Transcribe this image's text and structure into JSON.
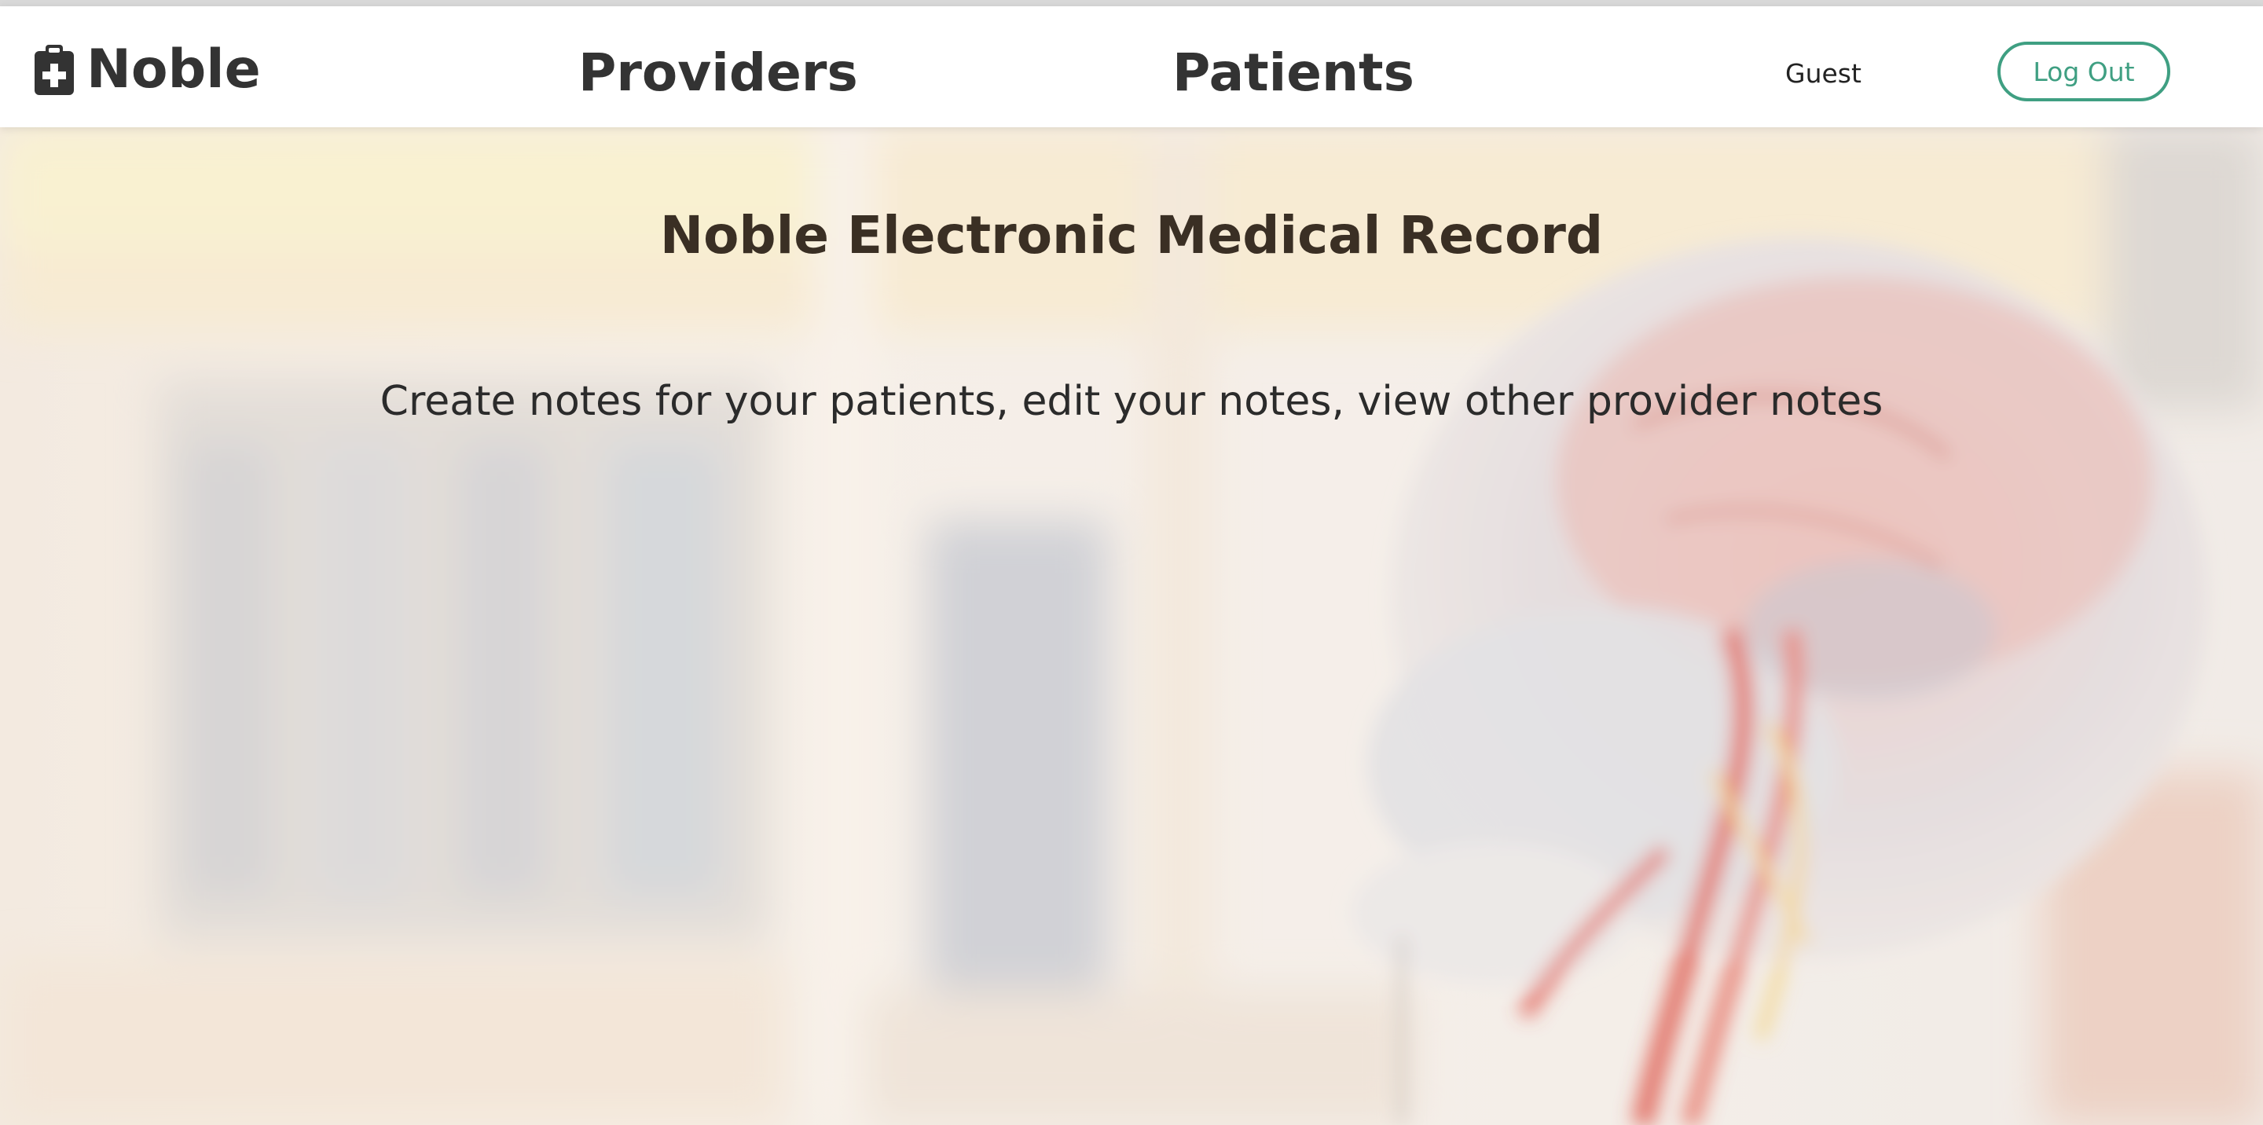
{
  "navbar": {
    "brand": {
      "label": "Noble",
      "icon": "clipboard-plus-icon"
    },
    "links": [
      {
        "label": "Providers"
      },
      {
        "label": "Patients"
      }
    ],
    "user": {
      "name": "Guest"
    },
    "logout_label": "Log Out",
    "colors": {
      "accent": "#3f9f82",
      "text": "#333333"
    }
  },
  "hero": {
    "title": "Noble Electronic Medical Record",
    "subtitle": "Create notes for your patients, edit your notes, view other provider notes"
  }
}
